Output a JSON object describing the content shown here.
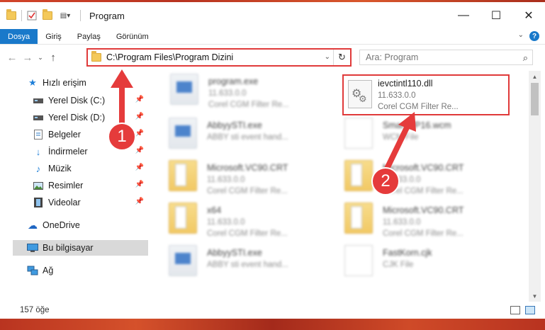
{
  "window": {
    "title": "Program"
  },
  "ribbon": {
    "tabs": [
      "Dosya",
      "Giriş",
      "Paylaş",
      "Görünüm"
    ],
    "active_tab": "Dosya"
  },
  "address": {
    "path": "C:\\Program Files\\Program Dizini"
  },
  "search": {
    "placeholder": "Ara: Program"
  },
  "sidebar": {
    "items": [
      {
        "label": "Hızlı erişim",
        "icon": "star-icon"
      },
      {
        "label": "Yerel Disk (C:)",
        "icon": "drive-icon",
        "pinned": true
      },
      {
        "label": "Yerel Disk (D:)",
        "icon": "drive-icon",
        "pinned": true
      },
      {
        "label": "Belgeler",
        "icon": "documents-icon",
        "pinned": true
      },
      {
        "label": "İndirmeler",
        "icon": "download-icon",
        "pinned": true
      },
      {
        "label": "Müzik",
        "icon": "music-icon",
        "pinned": true
      },
      {
        "label": "Resimler",
        "icon": "pictures-icon",
        "pinned": true
      },
      {
        "label": "Videolar",
        "icon": "videos-icon",
        "pinned": true
      },
      {
        "label": "OneDrive",
        "icon": "onedrive-icon"
      },
      {
        "label": "Bu bilgisayar",
        "icon": "computer-icon",
        "selected": true
      },
      {
        "label": "Ağ",
        "icon": "network-icon"
      }
    ]
  },
  "files": [
    {
      "name": "program.exe",
      "line1": "11.633.0.0",
      "line2": "Corel CGM Filter Re...",
      "icon": "exe"
    },
    {
      "name": "ievctintl110.dll",
      "line1": "11.633.0.0",
      "line2": "Corel CGM Filter Re...",
      "icon": "dll",
      "highlighted": true
    },
    {
      "name": "AbbyySTI.exe",
      "line1": "ABBY sti event hand...",
      "line2": "",
      "icon": "exe"
    },
    {
      "name": "SmartWP16.wcm",
      "line1": "WCM File",
      "line2": "",
      "icon": "doc"
    },
    {
      "name": "Microsoft.VC90.CRT",
      "line1": "11.633.0.0",
      "line2": "Corel CGM Filter Re...",
      "icon": "folder"
    },
    {
      "name": "Microsoft.VC90.CRT",
      "line1": "11.633.0.0",
      "line2": "Corel CGM Filter Re...",
      "icon": "folder"
    },
    {
      "name": "x64",
      "line1": "11.633.0.0",
      "line2": "Corel CGM Filter Re...",
      "icon": "folder"
    },
    {
      "name": "Microsoft.VC90.CRT",
      "line1": "11.633.0.0",
      "line2": "Corel CGM Filter Re...",
      "icon": "folder"
    },
    {
      "name": "AbbyySTI.exe",
      "line1": "ABBY sti event hand...",
      "line2": "",
      "icon": "exe"
    },
    {
      "name": "FastKorn.cjk",
      "line1": "CJK File",
      "line2": "",
      "icon": "doc"
    }
  ],
  "status": {
    "item_count": "157 öğe"
  },
  "annotations": {
    "step1": "1",
    "step2": "2",
    "color": "#e53b3b"
  }
}
